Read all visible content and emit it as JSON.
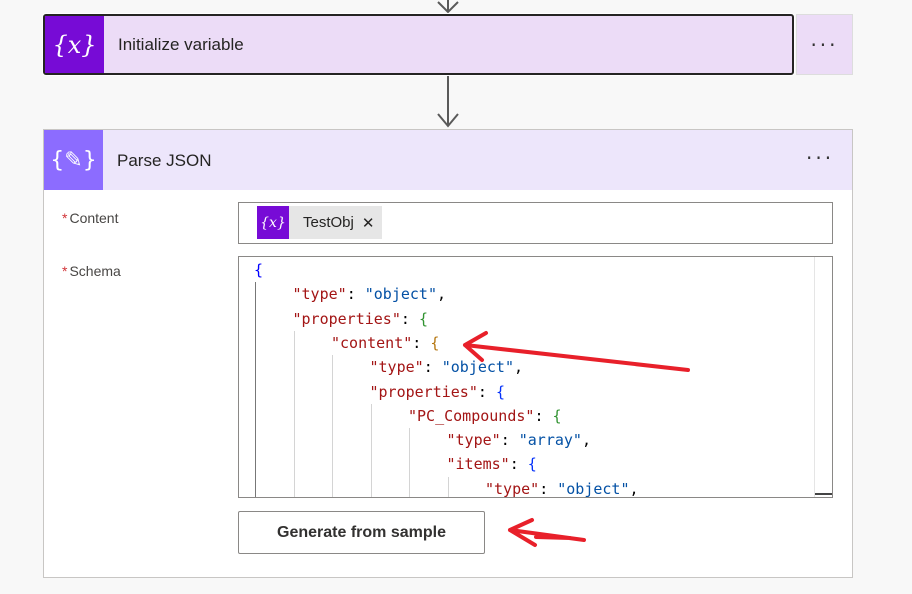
{
  "flow": {
    "step1": {
      "title": "Initialize variable",
      "icon": "variable-icon",
      "color": "#770bd6"
    },
    "step2": {
      "title": "Parse JSON",
      "icon": "parse-json-icon",
      "color": "#8c6cff",
      "content_label": "Content",
      "content_token": "TestObj",
      "schema_label": "Schema",
      "generate_button": "Generate from sample",
      "schema_lines": [
        {
          "level": 0,
          "tokens": [
            [
              "p",
              "{"
            ]
          ],
          "brace": "#0000ff"
        },
        {
          "level": 1,
          "tokens": [
            [
              "k",
              "\"type\""
            ],
            [
              "p",
              ": "
            ],
            [
              "s",
              "\"object\""
            ],
            [
              "p",
              ","
            ]
          ]
        },
        {
          "level": 1,
          "tokens": [
            [
              "k",
              "\"properties\""
            ],
            [
              "p",
              ": "
            ]
          ],
          "open": "{",
          "brace": "#319331"
        },
        {
          "level": 2,
          "tokens": [
            [
              "k",
              "\"content\""
            ],
            [
              "p",
              ": "
            ]
          ],
          "open": "{",
          "brace": "#b5760f"
        },
        {
          "level": 3,
          "tokens": [
            [
              "k",
              "\"type\""
            ],
            [
              "p",
              ": "
            ],
            [
              "s",
              "\"object\""
            ],
            [
              "p",
              ","
            ]
          ]
        },
        {
          "level": 3,
          "tokens": [
            [
              "k",
              "\"properties\""
            ],
            [
              "p",
              ": "
            ]
          ],
          "open": "{",
          "brace": "#0431fa"
        },
        {
          "level": 4,
          "tokens": [
            [
              "k",
              "\"PC_Compounds\""
            ],
            [
              "p",
              ": "
            ]
          ],
          "open": "{",
          "brace": "#319331"
        },
        {
          "level": 5,
          "tokens": [
            [
              "k",
              "\"type\""
            ],
            [
              "p",
              ": "
            ],
            [
              "s",
              "\"array\""
            ],
            [
              "p",
              ","
            ]
          ]
        },
        {
          "level": 5,
          "tokens": [
            [
              "k",
              "\"items\""
            ],
            [
              "p",
              ": "
            ]
          ],
          "open": "{",
          "brace": "#0431fa"
        },
        {
          "level": 6,
          "tokens": [
            [
              "k",
              "\"type\""
            ],
            [
              "p",
              ": "
            ],
            [
              "s",
              "\"object\""
            ],
            [
              "p",
              ","
            ]
          ]
        }
      ]
    }
  },
  "more_label": "···",
  "annotation_color": "#e8202a"
}
